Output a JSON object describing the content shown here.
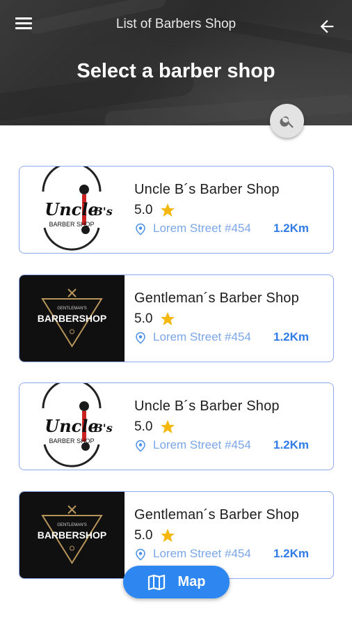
{
  "header": {
    "title": "List of Barbers Shop",
    "heading": "Select a barber shop"
  },
  "shops": [
    {
      "name": "Uncle B´s  Barber Shop",
      "rating": "5.0",
      "address": "Lorem Street #454",
      "distance": "1.2Km",
      "logo": "uncle-bs-logo"
    },
    {
      "name": "Gentleman´s  Barber Shop",
      "rating": "5.0",
      "address": "Lorem Street #454",
      "distance": "1.2Km",
      "logo": "gentlemans-barbershop-logo"
    },
    {
      "name": "Uncle B´s  Barber Shop",
      "rating": "5.0",
      "address": "Lorem Street #454",
      "distance": "1.2Km",
      "logo": "uncle-bs-logo"
    },
    {
      "name": "Gentleman´s  Barber Shop",
      "rating": "5.0",
      "address": "Lorem Street #454",
      "distance": "1.2Km",
      "logo": "gentlemans-barbershop-logo"
    }
  ],
  "logos": {
    "uncle": {
      "top": "Uncle",
      "sub": "B's",
      "tag": "BARBER SHOP"
    },
    "gent": {
      "top": "GENTLEMAN'S",
      "main": "BARBERSHOP"
    }
  },
  "map_button": {
    "label": "Map"
  },
  "colors": {
    "accent": "#2e86f0",
    "card_border": "#8fa8f0",
    "address": "#7ba7e8",
    "star": "#f5b70a",
    "logo_gold": "#b8955a"
  }
}
